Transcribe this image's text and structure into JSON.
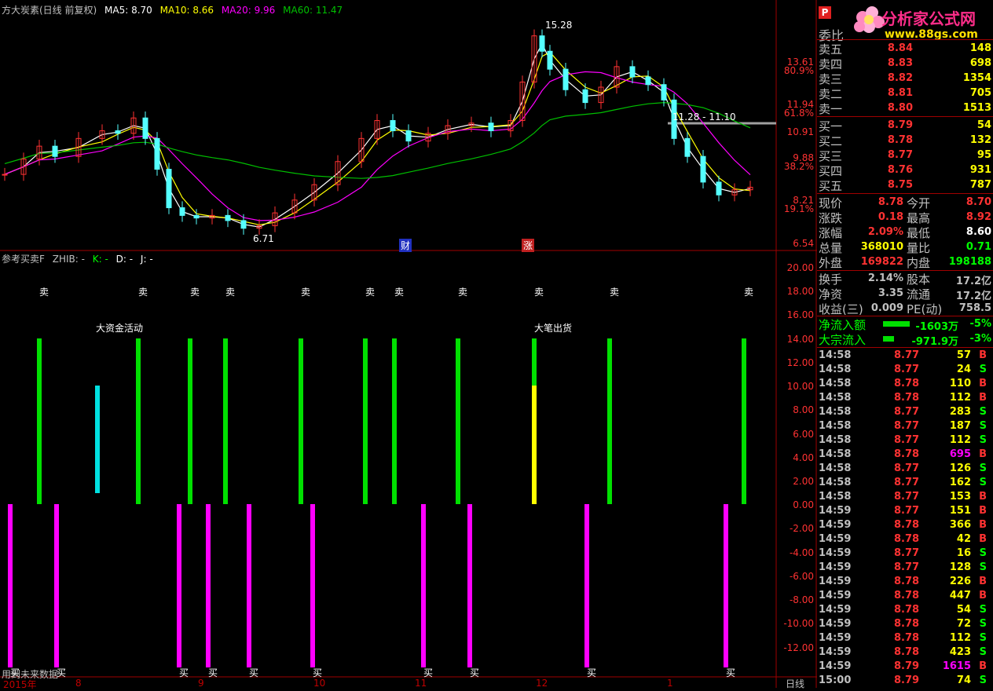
{
  "colors": {
    "up": "#ff3232",
    "down": "#54ffff",
    "ma5": "#ffffff",
    "ma10": "#ffff00",
    "ma20": "#ff00ff",
    "ma60": "#00c000",
    "grid": "#a00000",
    "bar_green": "#00e000",
    "bar_cyan": "#00e0e0",
    "bar_yellow": "#ffff00",
    "bar_magenta": "#ff00ff"
  },
  "legend": {
    "title": "方大炭素(日线 前复权)",
    "ma5": "MA5: 8.70",
    "ma10": "MA10: 8.66",
    "ma20": "MA20: 9.96",
    "ma60": "MA60: 11.47"
  },
  "price_axis": {
    "labels": [
      "13.61",
      "80.9%",
      "11.94",
      "61.8%",
      "10.91",
      "9.88",
      "38.2%",
      "8.21",
      "19.1%",
      "6.54"
    ]
  },
  "price_annotations": {
    "high": "15.28",
    "low": "6.71",
    "range": "11.28 - 11.10",
    "marker_cai": "财",
    "marker_zhang": "涨"
  },
  "indicator": {
    "legend_name": "参考买卖F",
    "legend_zhib": "ZHIB: -",
    "legend_k": "K: -",
    "legend_d": "D: -",
    "legend_j": "J: -",
    "sell_label": "卖",
    "buy_label": "买",
    "note_big_money": "大资金活动",
    "note_big_sell": "大笔出货",
    "axis_labels": [
      "20.00",
      "18.00",
      "16.00",
      "14.00",
      "12.00",
      "10.00",
      "8.00",
      "6.00",
      "4.00",
      "2.00",
      "0.00",
      "-2.00",
      "-4.00",
      "-6.00",
      "-8.00",
      "-10.00",
      "-12.00"
    ],
    "footer_text": "用到未来数据"
  },
  "dates": [
    "2015年",
    "8",
    "9",
    "10",
    "11",
    "12",
    "1"
  ],
  "period_label": "日线",
  "logo": {
    "title": "分析家公式网",
    "url": "www.88gs.com",
    "p_icon": "P"
  },
  "quote": {
    "weibi_label": "委比",
    "asks": [
      {
        "label": "卖五",
        "price": "8.84",
        "vol": "148"
      },
      {
        "label": "卖四",
        "price": "8.83",
        "vol": "698"
      },
      {
        "label": "卖三",
        "price": "8.82",
        "vol": "1354"
      },
      {
        "label": "卖二",
        "price": "8.81",
        "vol": "705"
      },
      {
        "label": "卖一",
        "price": "8.80",
        "vol": "1513"
      }
    ],
    "bids": [
      {
        "label": "买一",
        "price": "8.79",
        "vol": "54"
      },
      {
        "label": "买二",
        "price": "8.78",
        "vol": "132"
      },
      {
        "label": "买三",
        "price": "8.77",
        "vol": "95"
      },
      {
        "label": "买四",
        "price": "8.76",
        "vol": "931"
      },
      {
        "label": "买五",
        "price": "8.75",
        "vol": "787"
      }
    ]
  },
  "stats": [
    {
      "l1": "现价",
      "v1": "8.78",
      "l2": "今开",
      "v2": "8.70",
      "c1": "#ff3232",
      "c2": "#ff3232"
    },
    {
      "l1": "涨跌",
      "v1": "0.18",
      "l2": "最高",
      "v2": "8.92",
      "c1": "#ff3232",
      "c2": "#ff3232"
    },
    {
      "l1": "涨幅",
      "v1": "2.09%",
      "l2": "最低",
      "v2": "8.60",
      "c1": "#ff3232",
      "c2": "#ffffff"
    },
    {
      "l1": "总量",
      "v1": "368010",
      "l2": "量比",
      "v2": "0.71",
      "c1": "#ffff00",
      "c2": "#00ff00"
    },
    {
      "l1": "外盘",
      "v1": "169822",
      "l2": "内盘",
      "v2": "198188",
      "c1": "#ff3232",
      "c2": "#00ff00"
    },
    {
      "l1": "换手",
      "v1": "2.14%",
      "l2": "股本",
      "v2": "17.2亿",
      "c1": "#c0c0c0",
      "c2": "#c0c0c0"
    },
    {
      "l1": "净资",
      "v1": "3.35",
      "l2": "流通",
      "v2": "17.2亿",
      "c1": "#c0c0c0",
      "c2": "#c0c0c0"
    },
    {
      "l1": "收益(三)",
      "v1": "0.009",
      "l2": "PE(动)",
      "v2": "758.5",
      "c1": "#c0c0c0",
      "c2": "#c0c0c0"
    }
  ],
  "flows": [
    {
      "label": "净流入额",
      "value": "-1603万",
      "pct": "-5%"
    },
    {
      "label": "大宗流入",
      "value": "-971.9万",
      "pct": "-3%"
    }
  ],
  "ticks": [
    {
      "t": "14:58",
      "p": "8.77",
      "v": "57",
      "d": "B"
    },
    {
      "t": "14:58",
      "p": "8.77",
      "v": "24",
      "d": "S"
    },
    {
      "t": "14:58",
      "p": "8.78",
      "v": "110",
      "d": "B"
    },
    {
      "t": "14:58",
      "p": "8.78",
      "v": "112",
      "d": "B"
    },
    {
      "t": "14:58",
      "p": "8.77",
      "v": "283",
      "d": "S"
    },
    {
      "t": "14:58",
      "p": "8.77",
      "v": "187",
      "d": "S"
    },
    {
      "t": "14:58",
      "p": "8.77",
      "v": "112",
      "d": "S"
    },
    {
      "t": "14:58",
      "p": "8.78",
      "v": "695",
      "d": "B"
    },
    {
      "t": "14:58",
      "p": "8.77",
      "v": "126",
      "d": "S"
    },
    {
      "t": "14:58",
      "p": "8.77",
      "v": "162",
      "d": "S"
    },
    {
      "t": "14:58",
      "p": "8.77",
      "v": "153",
      "d": "B"
    },
    {
      "t": "14:59",
      "p": "8.77",
      "v": "151",
      "d": "B"
    },
    {
      "t": "14:59",
      "p": "8.78",
      "v": "366",
      "d": "B"
    },
    {
      "t": "14:59",
      "p": "8.78",
      "v": "42",
      "d": "B"
    },
    {
      "t": "14:59",
      "p": "8.77",
      "v": "16",
      "d": "S"
    },
    {
      "t": "14:59",
      "p": "8.77",
      "v": "128",
      "d": "S"
    },
    {
      "t": "14:59",
      "p": "8.78",
      "v": "226",
      "d": "B"
    },
    {
      "t": "14:59",
      "p": "8.78",
      "v": "447",
      "d": "B"
    },
    {
      "t": "14:59",
      "p": "8.78",
      "v": "54",
      "d": "S"
    },
    {
      "t": "14:59",
      "p": "8.78",
      "v": "72",
      "d": "S"
    },
    {
      "t": "14:59",
      "p": "8.78",
      "v": "112",
      "d": "S"
    },
    {
      "t": "14:59",
      "p": "8.78",
      "v": "423",
      "d": "S"
    },
    {
      "t": "14:59",
      "p": "8.79",
      "v": "1615",
      "d": "B"
    },
    {
      "t": "15:00",
      "p": "8.79",
      "v": "74",
      "d": "S"
    }
  ]
}
